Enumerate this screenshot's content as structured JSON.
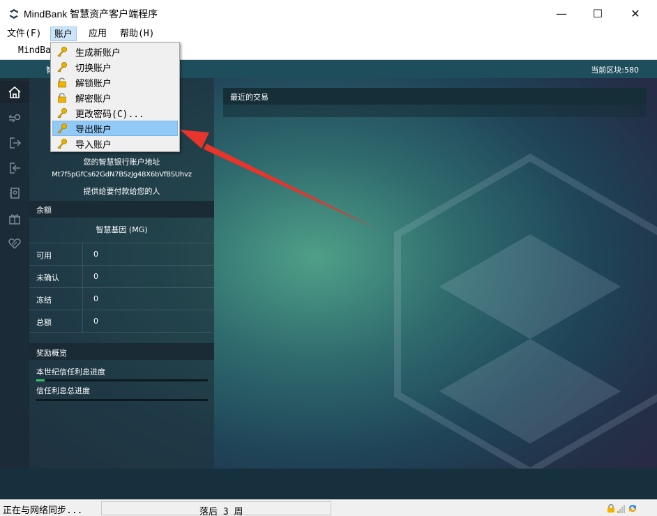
{
  "window": {
    "title": "MindBank 智慧资产客户端程序",
    "minimize": "—",
    "maximize": "☐",
    "close": "✕"
  },
  "menubar": {
    "items": [
      {
        "label": "文件(F)"
      },
      {
        "label": "账户"
      },
      {
        "label": "应用"
      },
      {
        "label": "帮助(H)"
      }
    ]
  },
  "tab": {
    "label": "MindBa"
  },
  "header": {
    "truncated_label": "智",
    "current_block": "当前区块:580"
  },
  "account_menu": {
    "items": [
      {
        "label": "生成新账户",
        "icon": "key-icon"
      },
      {
        "label": "切换账户",
        "icon": "key-icon"
      },
      {
        "label": "解锁账户",
        "icon": "unlock-icon"
      },
      {
        "label": "解密账户",
        "icon": "unlock-icon"
      },
      {
        "label": "更改密码(C)...",
        "icon": "key-icon"
      },
      {
        "label": "导出账户",
        "icon": "key-icon",
        "highlighted": true
      },
      {
        "label": "导入账户",
        "icon": "key-icon"
      }
    ]
  },
  "sidebar_nav": [
    {
      "name": "home-icon"
    },
    {
      "name": "transfer-icon"
    },
    {
      "name": "send-icon"
    },
    {
      "name": "receive-icon"
    },
    {
      "name": "address-book-icon"
    },
    {
      "name": "gift-icon"
    },
    {
      "name": "heart-icon"
    }
  ],
  "account": {
    "address_title": "您的智慧银行账户地址",
    "address": "Mt7f5pGfCs62GdN7BSzJg48X6bVfBSUhvz",
    "address_hint": "提供给要付款给您的人"
  },
  "balance": {
    "heading": "余额",
    "currency": "智慧基因 (MG)",
    "rows": [
      {
        "label": "可用",
        "value": "0"
      },
      {
        "label": "未确认",
        "value": "0"
      },
      {
        "label": "冻结",
        "value": "0"
      },
      {
        "label": "总额",
        "value": "0"
      }
    ]
  },
  "rewards": {
    "heading": "奖励概览",
    "century_label": "本世纪信任利息进度",
    "century_progress": 0.05,
    "total_label": "信任利息总进度",
    "total_progress": 0.0
  },
  "transactions": {
    "heading": "最近的交易"
  },
  "statusbar": {
    "sync_text": "正在与网络同步...",
    "behind_text": "落后 3 周"
  },
  "colors": {
    "highlight": "#91c9f7",
    "progress": "#38c060",
    "arrow": "#e8342a"
  }
}
